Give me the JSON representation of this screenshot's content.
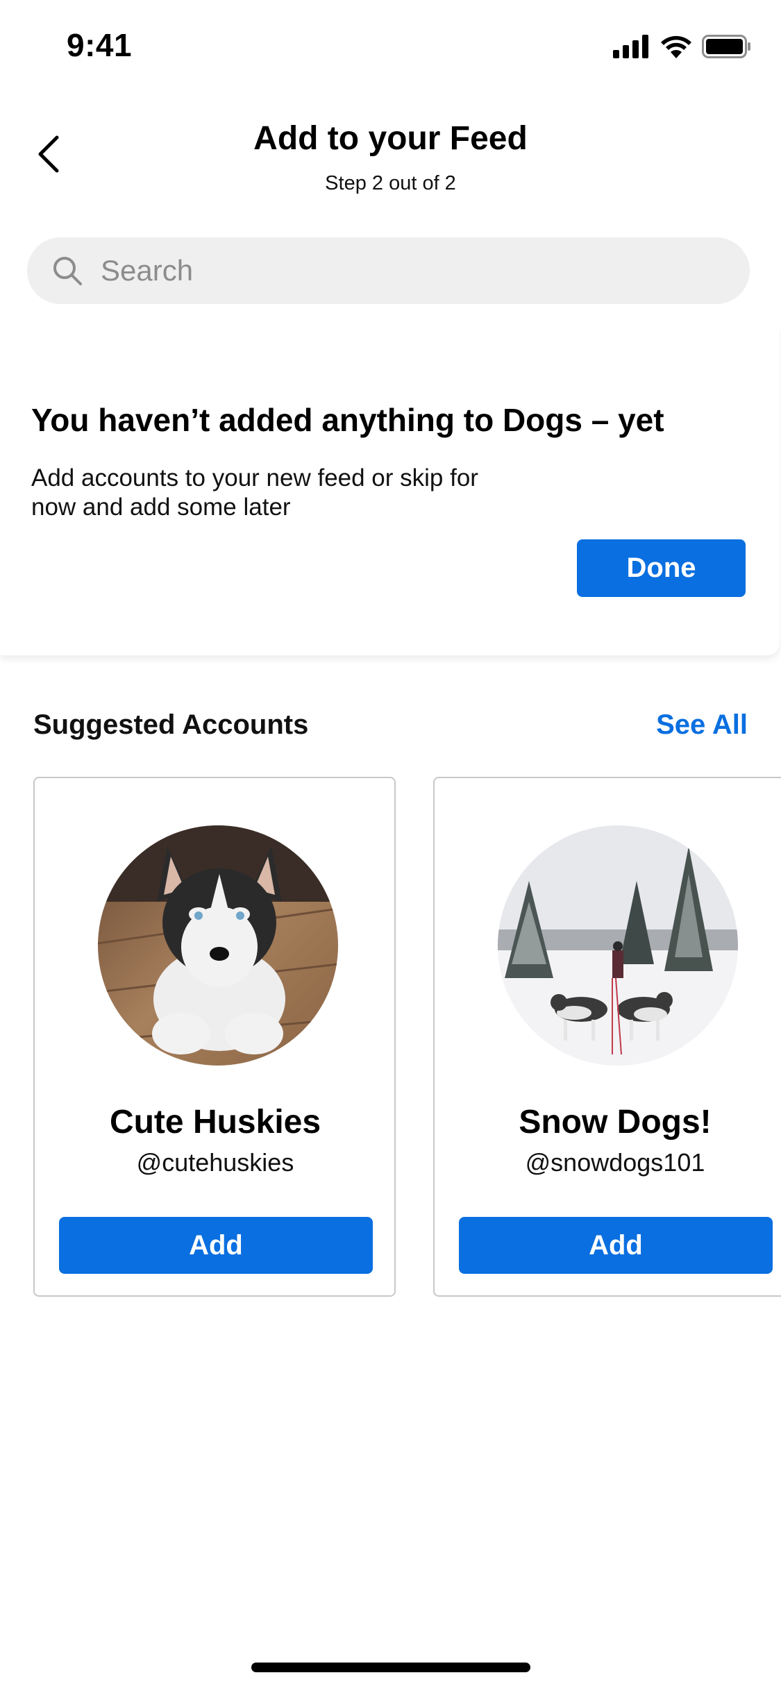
{
  "status_bar": {
    "time": "9:41",
    "icons": [
      "cellular-signal-icon",
      "wifi-icon",
      "battery-icon"
    ]
  },
  "header": {
    "back_icon": "chevron-left-icon",
    "title": "Add to your Feed",
    "step": "Step 2 out of 2"
  },
  "search": {
    "icon": "search-icon",
    "placeholder": "Search"
  },
  "empty_state": {
    "title": "You haven’t added anything to Dogs – yet",
    "description": "Add accounts to your new feed or skip for now and add some later",
    "done_label": "Done"
  },
  "suggested": {
    "title": "Suggested Accounts",
    "see_all_label": "See All",
    "accounts": [
      {
        "name": "Cute Huskies",
        "handle": "@cutehuskies",
        "add_label": "Add"
      },
      {
        "name": "Snow Dogs!",
        "handle": "@snowdogs101",
        "add_label": "Add"
      }
    ]
  },
  "colors": {
    "accent": "#0a6fe0",
    "search_bg": "#efefef",
    "card_border": "#c8c8c8"
  }
}
